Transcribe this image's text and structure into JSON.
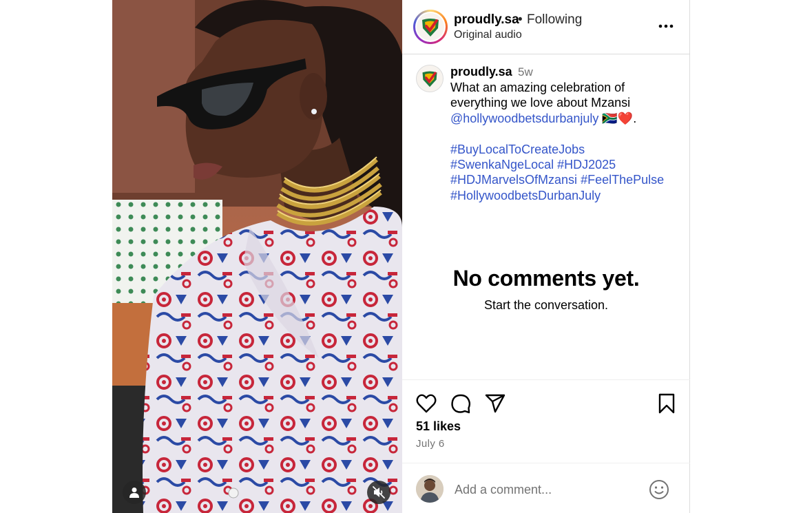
{
  "header": {
    "username": "proudly.sa",
    "separator": "•",
    "follow_status": "Following",
    "audio": "Original audio"
  },
  "post": {
    "username": "proudly.sa",
    "time_ago": "5w",
    "caption_lines": [
      "What an amazing celebration of",
      "everything we love about Mzansi"
    ],
    "mention": "@hollywoodbetsdurbanjuly",
    "mention_suffix": "🇿🇦❤️.",
    "hashtag_lines": [
      [
        "#BuyLocalToCreateJobs"
      ],
      [
        "#SwenkaNgeLocal",
        "#HDJ2025"
      ],
      [
        "#HDJMarvelsOfMzansi",
        "#FeelThePulse"
      ],
      [
        "#HollywoodbetsDurbanJuly"
      ]
    ]
  },
  "comments_empty": {
    "title": "No comments yet.",
    "subtitle": "Start the conversation."
  },
  "engagement": {
    "likes": "51 likes",
    "date": "July 6"
  },
  "comment_box": {
    "placeholder": "Add a comment..."
  },
  "icons": {
    "more": "more-horizontal-icon",
    "like": "heart-icon",
    "comment": "speech-bubble-icon",
    "share": "paper-plane-icon",
    "save": "bookmark-icon",
    "emoji": "smiley-icon",
    "tag": "user-tag-icon",
    "mute": "speaker-muted-icon"
  },
  "colors": {
    "link": "#3455c9",
    "secondary_text": "#737373",
    "border": "#dbdbdb",
    "media_button_bg": "#262626"
  }
}
